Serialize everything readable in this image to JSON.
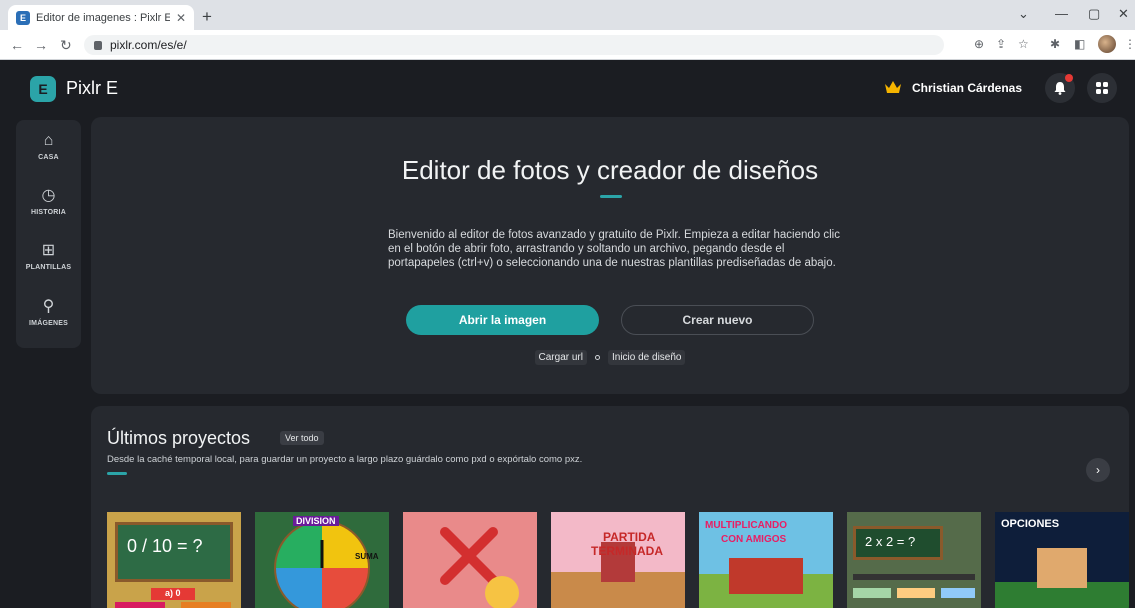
{
  "browser": {
    "tab_title": "Editor de imagenes : Pixlr E - Gra",
    "url": "pixlr.com/es/e/"
  },
  "header": {
    "brand": "Pixlr E",
    "user_name": "Christian Cárdenas"
  },
  "sidebar": {
    "items": [
      {
        "label": "CASA",
        "icon": "home-icon"
      },
      {
        "label": "HISTORIA",
        "icon": "clock-icon"
      },
      {
        "label": "PLANTILLAS",
        "icon": "template-icon"
      },
      {
        "label": "IMÁGENES",
        "icon": "search-icon"
      }
    ]
  },
  "hero": {
    "title": "Editor de fotos y creador de diseños",
    "description": "Bienvenido al editor de fotos avanzado y gratuito de Pixlr. Empieza a editar haciendo clic en el botón de abrir foto, arrastrando y soltando un archivo, pegando desde el portapapeles (ctrl+v) o seleccionando una de nuestras plantillas prediseñadas de abajo.",
    "open_button": "Abrir la imagen",
    "new_button": "Crear nuevo",
    "load_url": "Cargar url",
    "design_start": "Inicio de diseño"
  },
  "recent": {
    "title": "Últimos proyectos",
    "see_all": "Ver todo",
    "subtitle": "Desde la caché temporal local, para guardar un proyecto a largo plazo guárdalo como pxd o expórtalo como pxz.",
    "thumbnails": [
      {
        "text": "0 / 10 = ?",
        "alt": "a) 0"
      },
      {
        "text": "DIVISION",
        "alt": "SUMA"
      },
      {
        "text": "",
        "alt": ""
      },
      {
        "text": "PARTIDA",
        "alt": "TERMINADA"
      },
      {
        "text": "MULTIPLICANDO",
        "alt": "CON AMIGOS"
      },
      {
        "text": "2 x 2 = ?",
        "alt": ""
      },
      {
        "text": "OPCIONES",
        "alt": ""
      }
    ]
  },
  "colors": {
    "accent": "#2ba4a8",
    "background": "#1b1d22",
    "panel": "#26292f"
  }
}
